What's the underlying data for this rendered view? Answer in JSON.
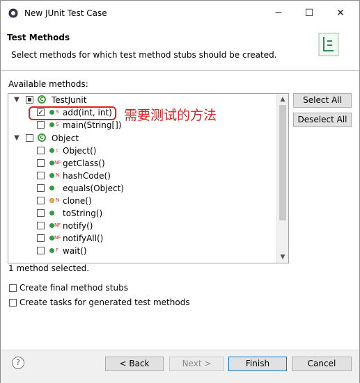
{
  "window": {
    "title": "New JUnit Test Case",
    "minimize": "─",
    "maximize": "☐",
    "close": "✕"
  },
  "header": {
    "title": "Test Methods",
    "description": "Select methods for which test method stubs should be created."
  },
  "available_label": "Available methods:",
  "tree": {
    "root": {
      "label": "TestJunit",
      "state": "partial"
    },
    "root_methods": [
      {
        "label": "add(int, int)",
        "sup": "S",
        "checked": true
      },
      {
        "label": "main(String[])",
        "sup": "S",
        "checked": false
      }
    ],
    "object": {
      "label": "Object",
      "state": "unchecked"
    },
    "object_methods": [
      {
        "label": "Object()",
        "sup": "c",
        "checked": false
      },
      {
        "label": "getClass()",
        "sup": "NF",
        "checked": false
      },
      {
        "label": "hashCode()",
        "sup": "N",
        "checked": false
      },
      {
        "label": "equals(Object)",
        "sup": "",
        "checked": false
      },
      {
        "label": "clone()",
        "sup": "N",
        "checked": false
      },
      {
        "label": "toString()",
        "sup": "",
        "checked": false
      },
      {
        "label": "notify()",
        "sup": "NF",
        "checked": false
      },
      {
        "label": "notifyAll()",
        "sup": "NF",
        "checked": false
      },
      {
        "label": "wait()",
        "sup": "F",
        "checked": false
      }
    ]
  },
  "buttons": {
    "select_all": "Select All",
    "deselect_all": "Deselect All",
    "back": "< Back",
    "next": "Next >",
    "finish": "Finish",
    "cancel": "Cancel"
  },
  "status": "1 method selected.",
  "options": {
    "final_stubs": "Create final method stubs",
    "tasks": "Create tasks for generated test methods"
  },
  "annotation": "需要测试的方法",
  "help": "?",
  "colors": {
    "accent": "#0078d7",
    "annotation": "#e02020",
    "method_public": "#2e9b3f",
    "method_protected": "#f0b24d"
  }
}
